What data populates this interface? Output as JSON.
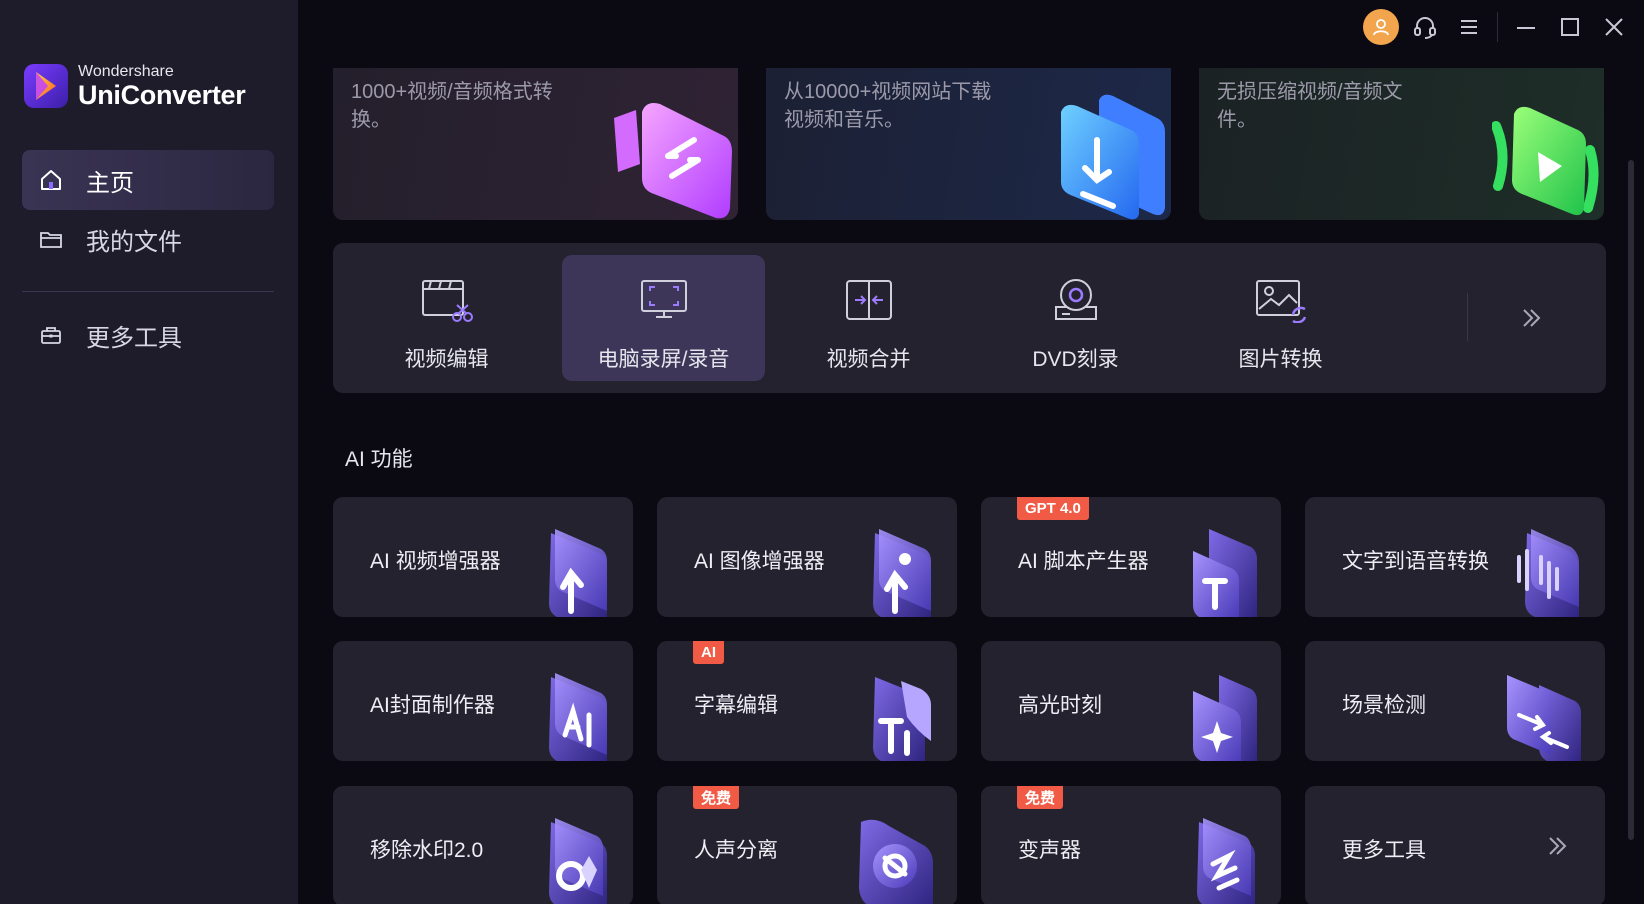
{
  "app": {
    "brand_sub": "Wondershare",
    "brand_main": "UniConverter"
  },
  "sidebar": {
    "items": [
      {
        "label": "主页",
        "icon": "home-icon",
        "active": true
      },
      {
        "label": "我的文件",
        "icon": "folder-icon",
        "active": false
      },
      {
        "label": "更多工具",
        "icon": "toolbox-icon",
        "active": false
      }
    ]
  },
  "banners": [
    {
      "text": "1000+视频/音频格式转换。"
    },
    {
      "text": "从10000+视频网站下载视频和音乐。"
    },
    {
      "text": "无损压缩视频/音频文件。"
    }
  ],
  "tools": [
    {
      "label": "视频编辑",
      "icon": "video-edit-icon",
      "active": false
    },
    {
      "label": "电脑录屏/录音",
      "icon": "screen-record-icon",
      "active": true
    },
    {
      "label": "视频合并",
      "icon": "video-merge-icon",
      "active": false
    },
    {
      "label": "DVD刻录",
      "icon": "dvd-burn-icon",
      "active": false
    },
    {
      "label": "图片转换",
      "icon": "image-convert-icon",
      "active": false
    }
  ],
  "ai_section": {
    "title": "AI 功能",
    "cards": [
      {
        "label": "AI 视频增强器",
        "badge": ""
      },
      {
        "label": "AI 图像增强器",
        "badge": ""
      },
      {
        "label": "AI 脚本产生器",
        "badge": "GPT 4.0"
      },
      {
        "label": "文字到语音转换",
        "badge": ""
      },
      {
        "label": "AI封面制作器",
        "badge": ""
      },
      {
        "label": "字幕编辑",
        "badge": "AI"
      },
      {
        "label": "高光时刻",
        "badge": ""
      },
      {
        "label": "场景检测",
        "badge": ""
      },
      {
        "label": "移除水印2.0",
        "badge": ""
      },
      {
        "label": "人声分离",
        "badge": "免费"
      },
      {
        "label": "变声器",
        "badge": "免费"
      },
      {
        "label": "更多工具",
        "badge": ""
      }
    ]
  },
  "colors": {
    "accent": "#6b57d6",
    "badge": "#f15a45",
    "avatar": "#f3a54d",
    "sidebar_bg": "#1e1c2b",
    "card_bg": "#24222f"
  }
}
